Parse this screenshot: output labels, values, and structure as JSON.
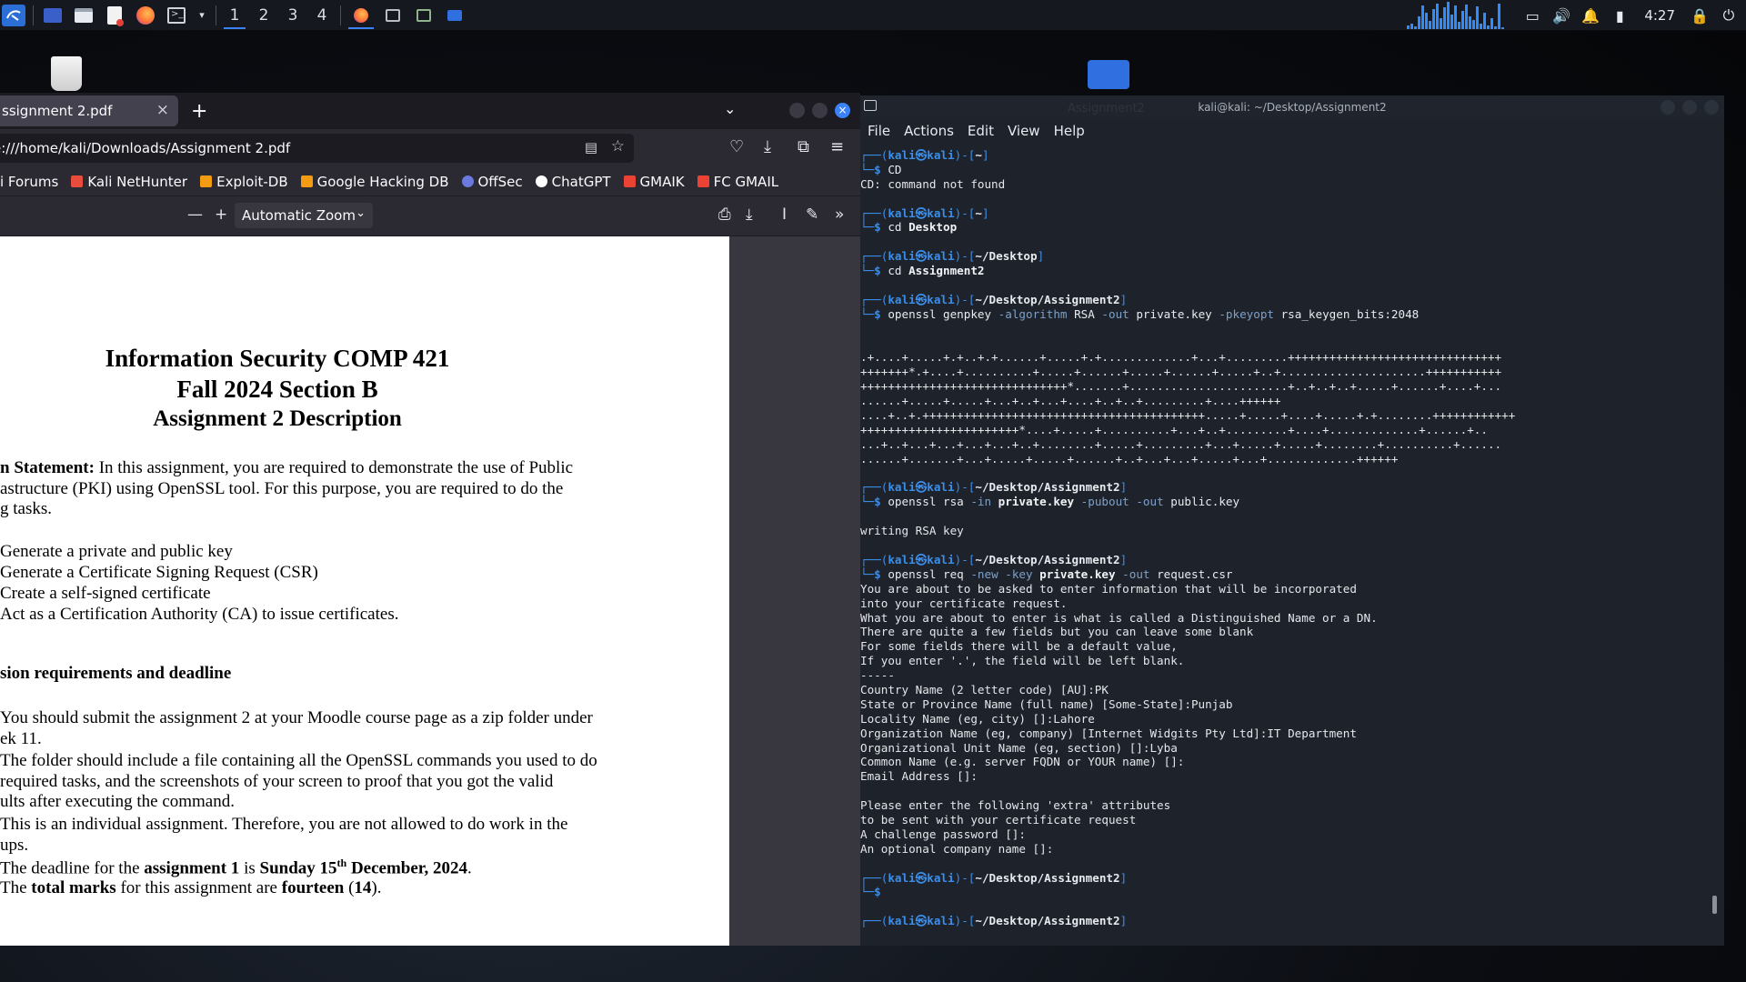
{
  "panel": {
    "workspaces": [
      "1",
      "2",
      "3",
      "4"
    ],
    "clock": "4:27"
  },
  "firefox": {
    "tab_title": "ssignment 2.pdf",
    "url": "e:///home/kali/Downloads/Assignment 2.pdf",
    "bookmarks": [
      {
        "label": "i Forums",
        "color": "#3b82f6"
      },
      {
        "label": "Kali NetHunter",
        "color": "#e74c3c"
      },
      {
        "label": "Exploit-DB",
        "color": "#f39c12"
      },
      {
        "label": "Google Hacking DB",
        "color": "#f39c12"
      },
      {
        "label": "OffSec",
        "color": "#6c7ae0"
      },
      {
        "label": "ChatGPT",
        "color": "#ffffff"
      },
      {
        "label": "GMAIK",
        "color": "#ea4335"
      },
      {
        "label": "FC GMAIL",
        "color": "#ea4335"
      }
    ],
    "zoom_label": "Automatic Zoom"
  },
  "pdf": {
    "title1": "Information Security COMP 421",
    "title2": "Fall 2024 Section B",
    "title3": "Assignment 2 Description",
    "ps_bold": "n Statement:",
    "ps_rest": " In this assignment, you are required to demonstrate the use of Public",
    "ps_l2": "astructure (PKI) using OpenSSL tool. For this purpose, you are required to do the",
    "ps_l3": "g tasks.",
    "tasks": [
      "Generate a private and public key",
      "Generate a Certificate Signing Request (CSR)",
      "Create a self-signed certificate",
      "Act as a Certification Authority (CA) to issue certificates."
    ],
    "sub_heading": "sion requirements and deadline",
    "r1a": "You should submit the assignment 2 at your Moodle course page as a zip folder under",
    "r1b": "ek 11.",
    "r2a": "The folder should include a file containing all the OpenSSL commands you used to do",
    "r2b": "required tasks, and the screenshots of your screen to proof that you got the valid",
    "r2c": "ults after executing the command.",
    "r3a": "This is an individual assignment. Therefore, you are not allowed to do work in the",
    "r3b": "ups.",
    "r4_pre": "The deadline for the ",
    "r4_b1": "assignment 1",
    "r4_mid": " is ",
    "r4_b2": "Sunday 15",
    "r4_sup": "th",
    "r4_b3": " December, 2024",
    "r4_end": ".",
    "r5_pre": "The ",
    "r5_b1": "total marks",
    "r5_mid": " for this assignment are ",
    "r5_b2": "fourteen",
    "r5_p1": " (",
    "r5_b3": "14",
    "r5_end": ")."
  },
  "terminal": {
    "title": "kali@kali: ~/Desktop/Assignment2",
    "ghost_title": "Assignment2",
    "menu": [
      "File",
      "Actions",
      "Edit",
      "View",
      "Help"
    ],
    "prompt_user": "kali",
    "prompt_at": "㉿",
    "prompt_host": "kali",
    "lines": [
      {
        "k": "p",
        "path": "~"
      },
      {
        "k": "c",
        "cmd": [
          [
            "cm",
            "CD"
          ]
        ]
      },
      {
        "k": "o",
        "t": "CD: command not found"
      },
      {
        "k": "b"
      },
      {
        "k": "p",
        "path": "~"
      },
      {
        "k": "c",
        "cmd": [
          [
            "cm",
            "cd "
          ],
          [
            "bd",
            "Desktop"
          ]
        ]
      },
      {
        "k": "b"
      },
      {
        "k": "p",
        "path": "~/Desktop"
      },
      {
        "k": "c",
        "cmd": [
          [
            "cm",
            "cd "
          ],
          [
            "bd",
            "Assignment2"
          ]
        ]
      },
      {
        "k": "b"
      },
      {
        "k": "p",
        "path": "~/Desktop/Assignment2"
      },
      {
        "k": "c",
        "cmd": [
          [
            "cm",
            "openssl genpkey "
          ],
          [
            "op",
            "-algorithm"
          ],
          [
            "cm",
            " RSA "
          ],
          [
            "op",
            "-out"
          ],
          [
            "cm",
            " private.key "
          ],
          [
            "op",
            "-pkeyopt"
          ],
          [
            "cm",
            " rsa_keygen_bits:2048"
          ]
        ]
      },
      {
        "k": "b"
      },
      {
        "k": "b"
      },
      {
        "k": "o",
        "t": ".+....+.....+.+..+.+......+.....+.+.............+...+.........+++++++++++++++++++++++++++++++"
      },
      {
        "k": "o",
        "t": "+++++++*.+....+..........+.....+......+.....+......+.....+..+.....................+++++++++++"
      },
      {
        "k": "o",
        "t": "++++++++++++++++++++++++++++++*.......+.......................+..+..+..+.....+......+....+..."
      },
      {
        "k": "o",
        "t": "......+.....+.....+...+..+...+....+..+..+.........+....++++++"
      },
      {
        "k": "o",
        "t": "....+..+.+++++++++++++++++++++++++++++++++++++++++.....+.....+....+.....+.+........++++++++++++"
      },
      {
        "k": "o",
        "t": "+++++++++++++++++++++++*....+.....+..........+...+..+.........+....+.............+......+.."
      },
      {
        "k": "o",
        "t": "...+..+...+...+...+...+..+........+.....+.........+...+.....+.....+........+..........+......"
      },
      {
        "k": "o",
        "t": "......+.......+...+.....+.....+......+..+...+...+.....+...+.............++++++"
      },
      {
        "k": "b"
      },
      {
        "k": "p",
        "path": "~/Desktop/Assignment2"
      },
      {
        "k": "c",
        "cmd": [
          [
            "cm",
            "openssl rsa "
          ],
          [
            "op",
            "-in"
          ],
          [
            "bd",
            " private.key "
          ],
          [
            "op",
            "-pubout -out"
          ],
          [
            "cm",
            " public.key"
          ]
        ]
      },
      {
        "k": "b"
      },
      {
        "k": "o",
        "t": "writing RSA key"
      },
      {
        "k": "b"
      },
      {
        "k": "p",
        "path": "~/Desktop/Assignment2"
      },
      {
        "k": "c",
        "cmd": [
          [
            "cm",
            "openssl req "
          ],
          [
            "op",
            "-new -key"
          ],
          [
            "bd",
            " private.key "
          ],
          [
            "op",
            "-out"
          ],
          [
            "cm",
            " request.csr"
          ]
        ]
      },
      {
        "k": "o",
        "t": "You are about to be asked to enter information that will be incorporated"
      },
      {
        "k": "o",
        "t": "into your certificate request."
      },
      {
        "k": "o",
        "t": "What you are about to enter is what is called a Distinguished Name or a DN."
      },
      {
        "k": "o",
        "t": "There are quite a few fields but you can leave some blank"
      },
      {
        "k": "o",
        "t": "For some fields there will be a default value,"
      },
      {
        "k": "o",
        "t": "If you enter '.', the field will be left blank."
      },
      {
        "k": "o",
        "t": "-----"
      },
      {
        "k": "o",
        "t": "Country Name (2 letter code) [AU]:PK"
      },
      {
        "k": "o",
        "t": "State or Province Name (full name) [Some-State]:Punjab"
      },
      {
        "k": "o",
        "t": "Locality Name (eg, city) []:Lahore"
      },
      {
        "k": "o",
        "t": "Organization Name (eg, company) [Internet Widgits Pty Ltd]:IT Department"
      },
      {
        "k": "o",
        "t": "Organizational Unit Name (eg, section) []:Lyba"
      },
      {
        "k": "o",
        "t": "Common Name (e.g. server FQDN or YOUR name) []:"
      },
      {
        "k": "o",
        "t": "Email Address []:"
      },
      {
        "k": "b"
      },
      {
        "k": "o",
        "t": "Please enter the following 'extra' attributes"
      },
      {
        "k": "o",
        "t": "to be sent with your certificate request"
      },
      {
        "k": "o",
        "t": "A challenge password []:"
      },
      {
        "k": "o",
        "t": "An optional company name []:"
      },
      {
        "k": "b"
      },
      {
        "k": "p",
        "path": "~/Desktop/Assignment2"
      },
      {
        "k": "c",
        "cmd": []
      },
      {
        "k": "b"
      },
      {
        "k": "p",
        "path": "~/Desktop/Assignment2"
      }
    ]
  },
  "colors": {
    "accent": "#3b82f6",
    "terminal_prompt": "#3b8eea",
    "panel": "#15181f"
  }
}
